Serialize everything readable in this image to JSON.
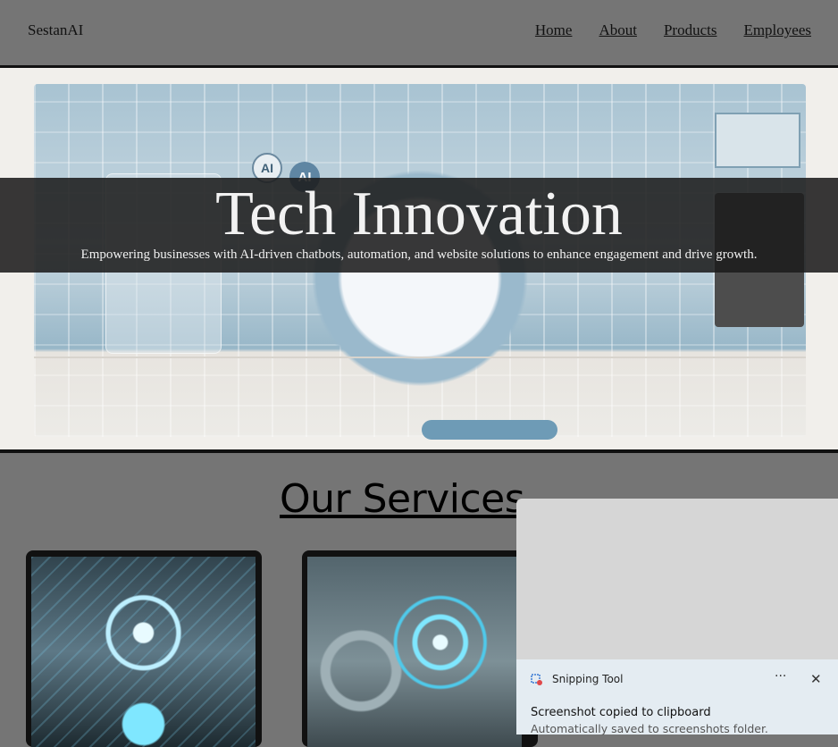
{
  "header": {
    "brand": "SestanAI",
    "nav": [
      {
        "label": "Home"
      },
      {
        "label": "About"
      },
      {
        "label": "Products"
      },
      {
        "label": "Employees"
      }
    ]
  },
  "hero": {
    "title": "Tech Innovation",
    "subtitle": "Empowering businesses with AI-driven chatbots, automation, and website solutions to enhance engagement and drive growth.",
    "badge_text": "AI",
    "badge_text_2": "AI"
  },
  "services": {
    "title": "Our Services",
    "cards": [
      {
        "image": "ai-chatbot-hologram"
      },
      {
        "image": "automation-gears"
      }
    ]
  },
  "notification": {
    "app_name": "Snipping Tool",
    "app_icon": "scissors-icon",
    "more_icon": "more-icon",
    "close_icon": "close-icon",
    "more_glyph": "···",
    "close_glyph": "✕",
    "heading": "Screenshot copied to clipboard",
    "body": "Automatically saved to screenshots folder."
  },
  "colors": {
    "page_background": "#757575",
    "overlay": "#1c1c1c",
    "toast_background": "#e4ecf2"
  }
}
